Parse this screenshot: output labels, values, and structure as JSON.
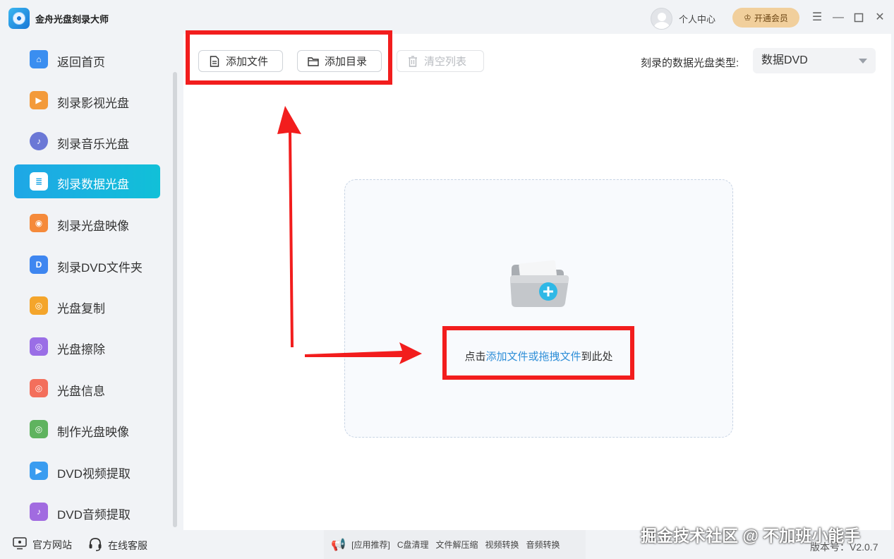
{
  "titlebar": {
    "app_title": "金舟光盘刻录大师",
    "user_center": "个人中心",
    "vip_label": "开通会员",
    "menu_icon": "menu-icon",
    "minimize_icon": "minimize-icon",
    "maximize_icon": "maximize-icon",
    "close_icon": "close-icon"
  },
  "sidebar": {
    "items": [
      {
        "label": "返回首页",
        "icon": "home-icon",
        "color": "#3a8ef0"
      },
      {
        "label": "刻录影视光盘",
        "icon": "video-disc-icon",
        "color": "#f39a3a"
      },
      {
        "label": "刻录音乐光盘",
        "icon": "music-disc-icon",
        "color": "#6b78d6"
      },
      {
        "label": "刻录数据光盘",
        "icon": "data-disc-icon",
        "color": "#ffffff"
      },
      {
        "label": "刻录光盘映像",
        "icon": "image-disc-icon",
        "color": "#f58a3a"
      },
      {
        "label": "刻录DVD文件夹",
        "icon": "dvd-folder-icon",
        "color": "#3e86f0"
      },
      {
        "label": "光盘复制",
        "icon": "copy-disc-icon",
        "color": "#f4a52b"
      },
      {
        "label": "光盘擦除",
        "icon": "erase-disc-icon",
        "color": "#9a6ee6"
      },
      {
        "label": "光盘信息",
        "icon": "info-disc-icon",
        "color": "#f36f5c"
      },
      {
        "label": "制作光盘映像",
        "icon": "make-image-icon",
        "color": "#5fb35f"
      },
      {
        "label": "DVD视频提取",
        "icon": "dvd-video-extract-icon",
        "color": "#3a9cf0"
      },
      {
        "label": "DVD音频提取",
        "icon": "dvd-audio-extract-icon",
        "color": "#a16be0"
      }
    ],
    "active_index": 3
  },
  "toolbar": {
    "add_file": "添加文件",
    "add_folder": "添加目录",
    "clear_list": "清空列表",
    "disc_type_label": "刻录的数据光盘类型:",
    "disc_type_value": "数据DVD"
  },
  "dropzone": {
    "prefix": "点击",
    "link": "添加文件或拖拽文件",
    "suffix": "到此处"
  },
  "bottom": {
    "website": "官方网站",
    "support": "在线客服",
    "promo_tag": "[应用推荐]",
    "promo_items": [
      "C盘清理",
      "文件解压缩",
      "视频转换",
      "音频转换"
    ],
    "watermark": "掘金技术社区 @ 不加班小能手",
    "version": "版本号：V2.0.7"
  },
  "colors": {
    "accent": "#1fa7e6",
    "annotation_red": "#f21d1d",
    "link": "#2f8fd8",
    "vip": "#f1cf9c"
  }
}
